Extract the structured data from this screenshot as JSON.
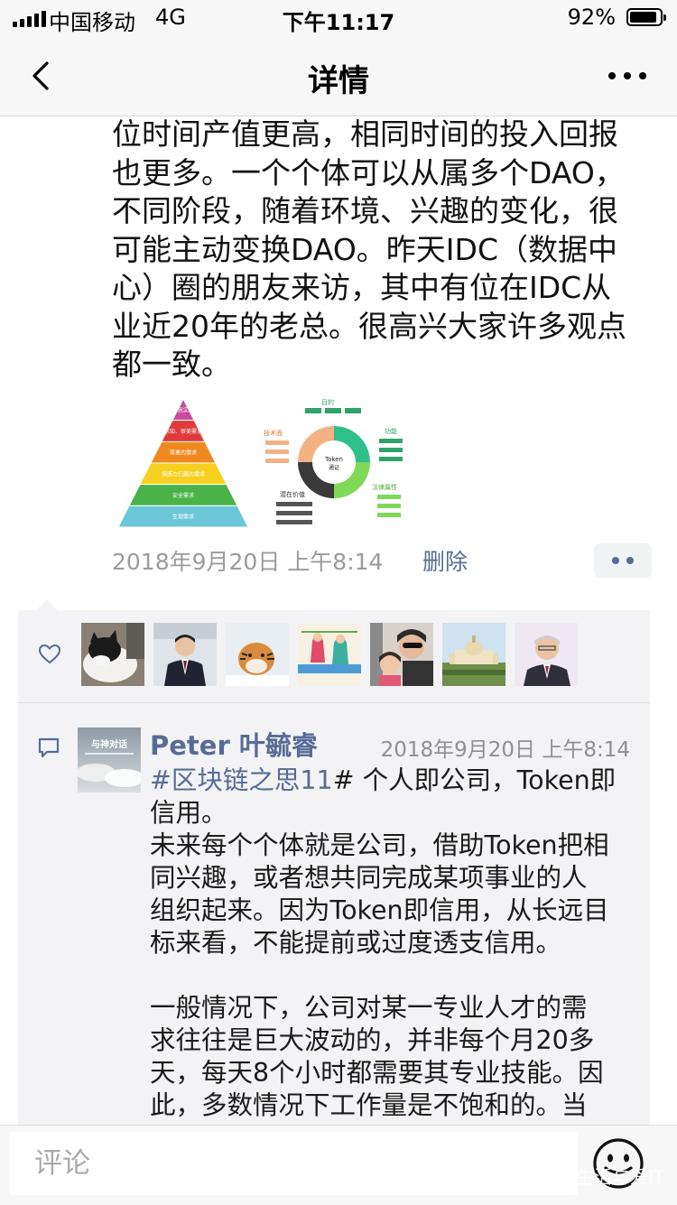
{
  "status_bar": {
    "carrier": "中国移动",
    "network": "4G",
    "time": "下午11:17",
    "battery_percent": "92%",
    "battery_level": 0.92
  },
  "nav": {
    "title": "详情",
    "back_icon": "chevron-left-icon",
    "more_icon": "more-dots-icon"
  },
  "post": {
    "text_lines": [
      "位时间产值更高，相同时间的投入回报",
      "也更多。一个个体可以从属多个DAO，",
      "不同阶段，随着环境、兴趣的变化，很",
      "可能主动变换DAO。昨天IDC（数据中",
      "心）圈的朋友来访，其中有位在IDC从",
      "业近20年的老总。很高兴大家许多观点",
      "都一致。"
    ],
    "images": {
      "pyramid": {
        "levels": [
          "自我实现",
          "求知、审美需求",
          "尊重的需求",
          "情感与归属的需求",
          "安全需求",
          "生理需求"
        ],
        "colors": [
          "#c94b9c",
          "#e03a3a",
          "#f08a20",
          "#f5d020",
          "#49b34a",
          "#6cc7d8"
        ]
      },
      "token": {
        "center_label": "Token",
        "center_sub": "通证",
        "labels": [
          "目的",
          "功能",
          "技术面",
          "法律属性",
          "潜在价值"
        ]
      }
    },
    "time": "2018年9月20日 上午8:14",
    "delete_label": "删除",
    "action_icon": "action-dots-icon"
  },
  "likes": {
    "icon": "heart-icon",
    "avatars": [
      "cat-avatar",
      "man-suit-avatar",
      "tiger-avatar",
      "drawing-avatar",
      "family-avatar",
      "palace-avatar",
      "elder-avatar"
    ]
  },
  "comment": {
    "icon": "comment-icon",
    "avatar_label": "与神对话",
    "name": "Peter 叶毓睿",
    "time": "2018年9月20日 上午8:14",
    "tag": "#区块链之思11",
    "line1_rest": "#  个人即公司，Token即",
    "lines": [
      "信用。",
      "未来每个个体就是公司，借助Token把相",
      "同兴趣，或者想共同完成某项事业的人",
      "组织起来。因为Token即信用，从长远目",
      "标来看，不能提前或过度透支信用。",
      "",
      "一般情况下，公司对某一专业人才的需",
      "求往往是巨大波动的，并非每个月20多",
      "天，每天8个小时都需要其专业技能。因",
      "此，多数情况下工作量是不饱和的。当"
    ]
  },
  "bottom": {
    "placeholder": "评论",
    "emoji_icon": "emoji-face-icon",
    "watermark": "乐生活与爱IT"
  },
  "colors": {
    "link": "#576b95",
    "meta": "#9b9b9b",
    "panel": "#f3f3f5"
  }
}
